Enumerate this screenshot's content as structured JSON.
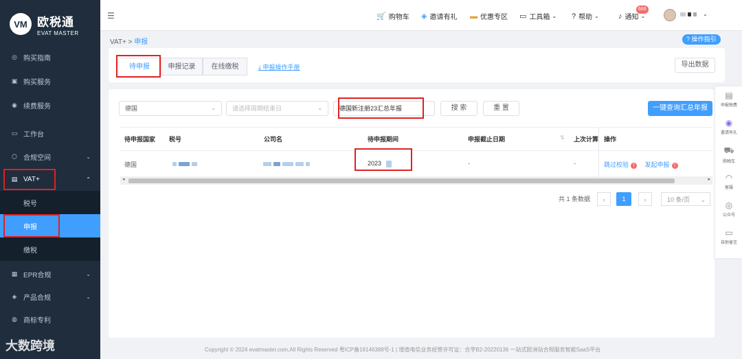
{
  "app": {
    "logo_mark": "VM",
    "logo_cn": "欧税通",
    "logo_en": "EVAT MASTER"
  },
  "sidebar": {
    "items": [
      {
        "label": "购买指南",
        "icon": "compass-icon"
      },
      {
        "label": "购买服务",
        "icon": "bag-icon"
      },
      {
        "label": "续费服务",
        "icon": "renew-icon"
      },
      {
        "label": "工作台",
        "icon": "monitor-icon"
      },
      {
        "label": "合规空间",
        "icon": "cube-icon"
      },
      {
        "label": "VAT+",
        "icon": "box-icon"
      },
      {
        "label": "税号",
        "icon": ""
      },
      {
        "label": "申报",
        "icon": ""
      },
      {
        "label": "缴税",
        "icon": ""
      },
      {
        "label": "EPR合规",
        "icon": "doc-icon"
      },
      {
        "label": "产品合规",
        "icon": "shield-icon"
      },
      {
        "label": "商标专利",
        "icon": "badge-icon"
      }
    ]
  },
  "topbar": {
    "cart": "购物车",
    "invite": "邀请有礼",
    "promo": "优惠专区",
    "toolbox": "工具箱",
    "help": "帮助",
    "notify": "通知",
    "notify_count": "666"
  },
  "breadcrumb": {
    "root": "VAT+",
    "sep": ">",
    "current": "申报"
  },
  "guide_btn": "操作指引",
  "tabs": [
    "待申报",
    "申报记录",
    "在线缴税"
  ],
  "manual_link": "申报操作手册",
  "export_btn": "导出数据",
  "filters": {
    "country": "德国",
    "period_placeholder": "请选择周期结束日",
    "company_value": "德国新注册23汇总年报",
    "search_btn": "搜 索",
    "reset_btn": "重 置",
    "batch_btn": "一键查询汇总年报"
  },
  "table": {
    "headers": [
      "待申报国家",
      "税号",
      "公司名",
      "待申报期间",
      "申报截止日期",
      "上次计算",
      "操作"
    ],
    "row": {
      "country": "德国",
      "period": "2023",
      "deadline": "-",
      "last_calc": "-",
      "action1": "跳过校验",
      "action2": "发起申报"
    }
  },
  "pagination": {
    "total": "共 1 条数据",
    "page": "1",
    "page_size": "10 条/页"
  },
  "dock": [
    "申报税费",
    "邀请有礼",
    "购物车",
    "客服",
    "公众号",
    "自助留言"
  ],
  "footer": "Copyright © 2024 evatmaster.com,All Rights Reserved 粤ICP备19146388号-1 | 增值电信业务经营许可证：合字B2-20220136      一站式欧洲站合规服务智能SaaS平台",
  "watermark": "大数跨境"
}
